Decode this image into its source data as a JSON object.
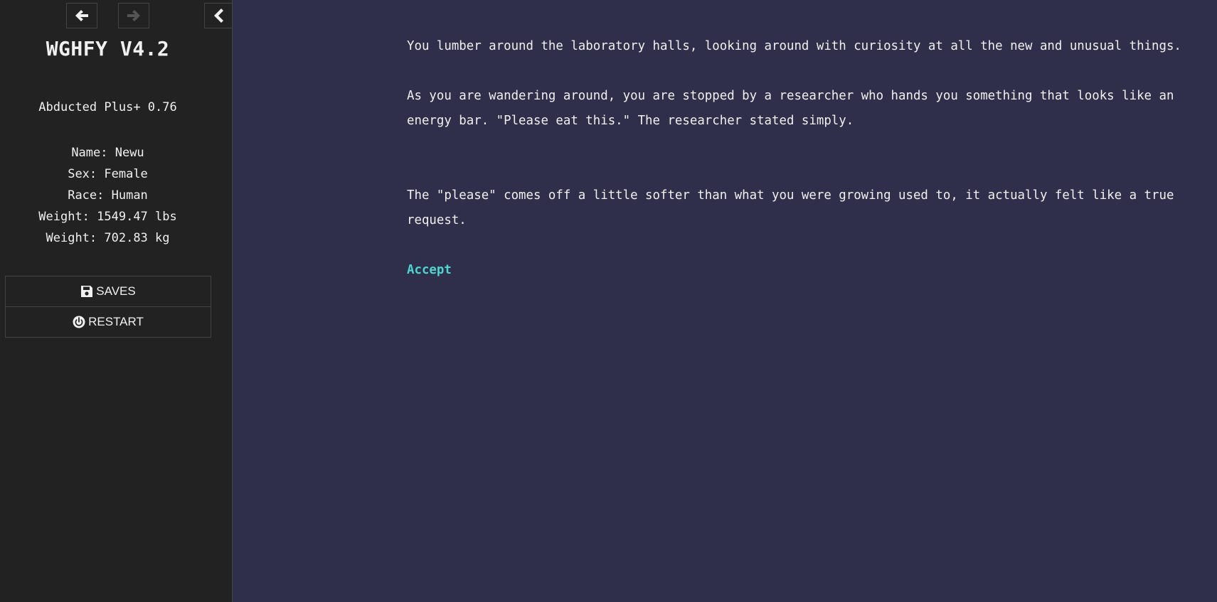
{
  "sidebar": {
    "title": "WGHFY V4.2",
    "subtitle": "Abducted Plus+ 0.76",
    "stats": [
      "Name: Newu",
      "Sex: Female",
      "Race: Human",
      "Weight: 1549.47 lbs",
      "Weight: 702.83 kg"
    ],
    "menu": {
      "saves_label": "SAVES",
      "restart_label": "RESTART"
    },
    "icons": {
      "back": "arrow-left-icon",
      "forward": "arrow-right-icon",
      "toggle": "chevron-left-icon",
      "saves": "floppy-disk-icon",
      "restart": "power-icon"
    }
  },
  "passage": {
    "paragraphs": [
      "You lumber around the laboratory halls, looking around with curiosity at all the new and unusual things.",
      "As you are wandering around, you are stopped by a researcher who hands you something that looks like an energy bar. \"Please eat this.\" The researcher stated simply.",
      "The \"please\" comes off a little softer than what you were growing used to, it actually felt like a true request."
    ],
    "choice_label": "Accept"
  },
  "colors": {
    "sidebar_bg": "#222222",
    "main_bg": "#2f2f4b",
    "text": "#f0f0f0",
    "link": "#4dd6d0",
    "border": "#444444"
  }
}
